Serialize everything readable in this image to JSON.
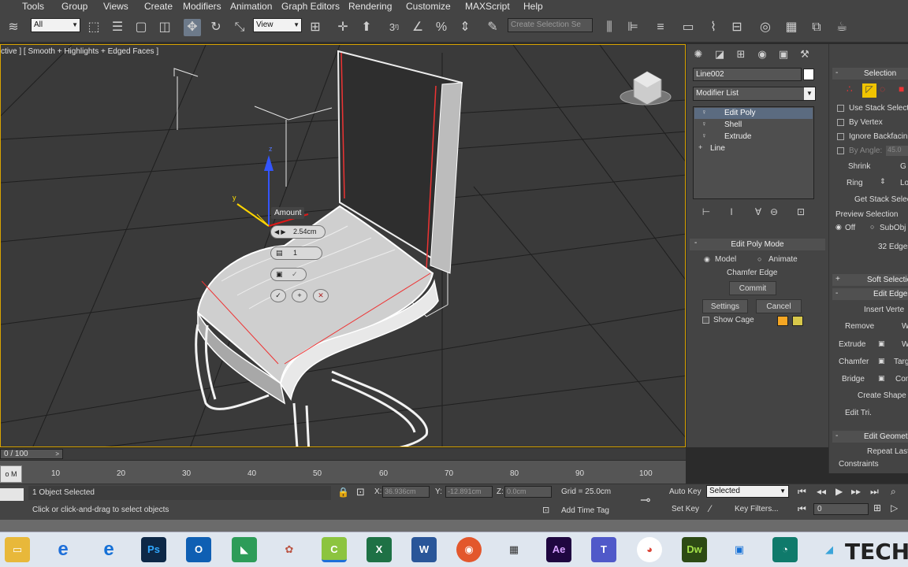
{
  "menu": [
    "Tools",
    "Group",
    "Views",
    "Create",
    "Modifiers",
    "Animation",
    "Graph Editors",
    "Rendering",
    "Customize",
    "MAXScript",
    "Help"
  ],
  "toolbar": {
    "selection_filter": "All",
    "ref_coord": "View",
    "named_selection_placeholder": "Create Selection Se"
  },
  "viewport": {
    "label": "ctive ] [ Smooth + Highlights + Edged Faces ]",
    "caddy_title": "Amount",
    "caddy_amount": "2.54cm",
    "caddy_segments": "1"
  },
  "command_panel": {
    "object_name": "Line002",
    "modifier_list_label": "Modifier List",
    "stack": [
      "Edit Poly",
      "Shell",
      "Extrude",
      "Line"
    ],
    "edit_poly_mode_title": "Edit Poly Mode",
    "model_label": "Model",
    "animate_label": "Animate",
    "current_op": "Chamfer Edge",
    "commit_label": "Commit",
    "settings_label": "Settings",
    "cancel_label": "Cancel",
    "show_cage_label": "Show Cage",
    "cage_color_1": "#f5a623",
    "cage_color_2": "#d8c84a"
  },
  "selection_panel": {
    "title": "Selection",
    "use_stack": "Use Stack Selecti",
    "by_vertex": "By Vertex",
    "ignore_backfacing": "Ignore Backfacin",
    "by_angle": "By Angle:",
    "by_angle_value": "45.0",
    "shrink": "Shrink",
    "grow": "G",
    "ring": "Ring",
    "loop": "Lo",
    "get_stack": "Get Stack Selec",
    "preview_selection": "Preview Selection",
    "off": "Off",
    "subobj": "SubObj",
    "edges_count": "32 Edges",
    "soft_selection": "Soft Selectio",
    "edit_edges": "Edit Edges",
    "insert_vertex": "Insert Verte",
    "remove": "Remove",
    "weld": "W",
    "extrude": "Extrude",
    "weld2": "W",
    "chamfer": "Chamfer",
    "target": "Targ",
    "bridge": "Bridge",
    "connect": "Con",
    "create_shape": "Create Shape",
    "edit_tri": "Edit Tri.",
    "edit_geometry": "Edit Geomet",
    "repeat_last": "Repeat Last",
    "constraints": "Constraints"
  },
  "timeline": {
    "frame": "0 / 100",
    "ticks": [
      "10",
      "20",
      "30",
      "40",
      "50",
      "60",
      "70",
      "80",
      "90",
      "100"
    ]
  },
  "status": {
    "objects_selected": "1 Object Selected",
    "prompt": "Click or click-and-drag to select objects",
    "x_label": "X:",
    "x_value": "36.936cm",
    "y_label": "Y:",
    "y_value": "-12.891cm",
    "z_label": "Z:",
    "z_value": "0.0cm",
    "grid": "Grid = 25.0cm",
    "add_time_tag": "Add Time Tag",
    "auto_key": "Auto Key",
    "set_key": "Set Key",
    "selected": "Selected",
    "key_filters": "Key Filters...",
    "frame_field": "0"
  },
  "taskbar": {
    "watermark": "TECH",
    "apps": [
      "Ps",
      "W",
      "Ae",
      "Dw"
    ]
  }
}
